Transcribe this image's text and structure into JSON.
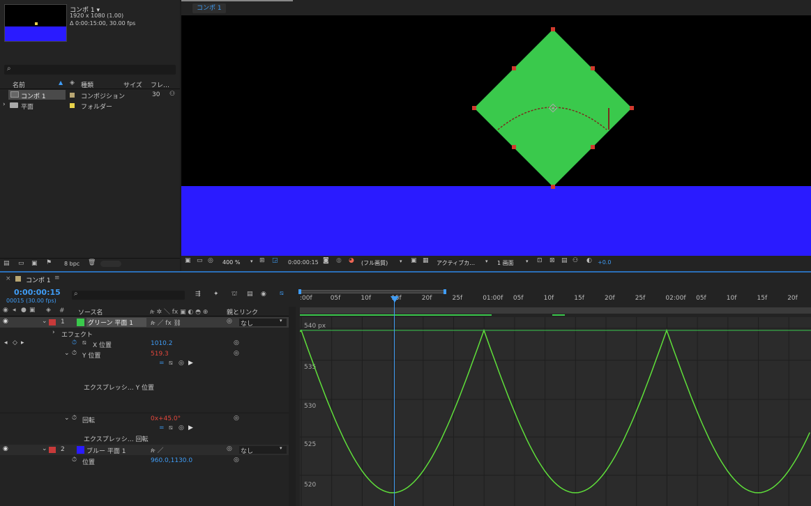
{
  "project": {
    "comp_name": "コンポ 1 ▾",
    "comp_res": "1920 x 1080 (1.00)",
    "comp_dur": "Δ 0:00:15:00, 30.00 fps",
    "search_placeholder": "",
    "columns": {
      "name": "名前",
      "type": "種類",
      "size": "サイズ",
      "frame": "フレ…"
    },
    "items": [
      {
        "name": "コンポ 1",
        "type": "コンポジション",
        "size": "30",
        "label_color": "#b9a773"
      },
      {
        "name": "平面",
        "type": "フォルダー",
        "size": "",
        "label_color": "#e8d24a"
      }
    ],
    "footer_bpc": "8 bpc"
  },
  "viewer": {
    "tab": "コンポ 1",
    "zoom": "400 %",
    "timecode": "0:00:00:15",
    "resolution": "(フル画質)",
    "camera": "アクティブカ…",
    "views": "1 画面",
    "exposure": "+0.0"
  },
  "timeline": {
    "tab": "コンポ 1",
    "timecode": "0:00:00:15",
    "frame_fps": "00015 (30.00 fps)",
    "col_source": "ソース名",
    "col_parent": "親とリンク",
    "time_ticks": [
      ":00f",
      "05f",
      "10f",
      "15f",
      "20f",
      "25f",
      "01:00f",
      "05f",
      "10f",
      "15f",
      "20f",
      "25f",
      "02:00f",
      "05f",
      "10f",
      "15f",
      "20f"
    ],
    "layers": [
      {
        "num": "1",
        "name": "グリーン 平面 1",
        "color": "#3ac94c",
        "parent": "なし"
      },
      {
        "num": "2",
        "name": "ブルー 平面 1",
        "color": "#2a1bff",
        "parent": "なし"
      }
    ],
    "effect_label": "エフェクト",
    "props": {
      "x_label": "X 位置",
      "x_value": "1010.2",
      "y_label": "Y 位置",
      "y_value": "519.3",
      "expr_y": "エクスプレッシ… Y 位置",
      "rot_label": "回転",
      "rot_value": "0x+45.0°",
      "expr_rot": "エクスプレッシ… 回転",
      "pos_label": "位置",
      "pos_value": "960.0,1130.0"
    }
  },
  "graph": {
    "y_labels": [
      "540 px",
      "535",
      "530",
      "525",
      "520"
    ],
    "curve_color": "#5fe03a"
  }
}
